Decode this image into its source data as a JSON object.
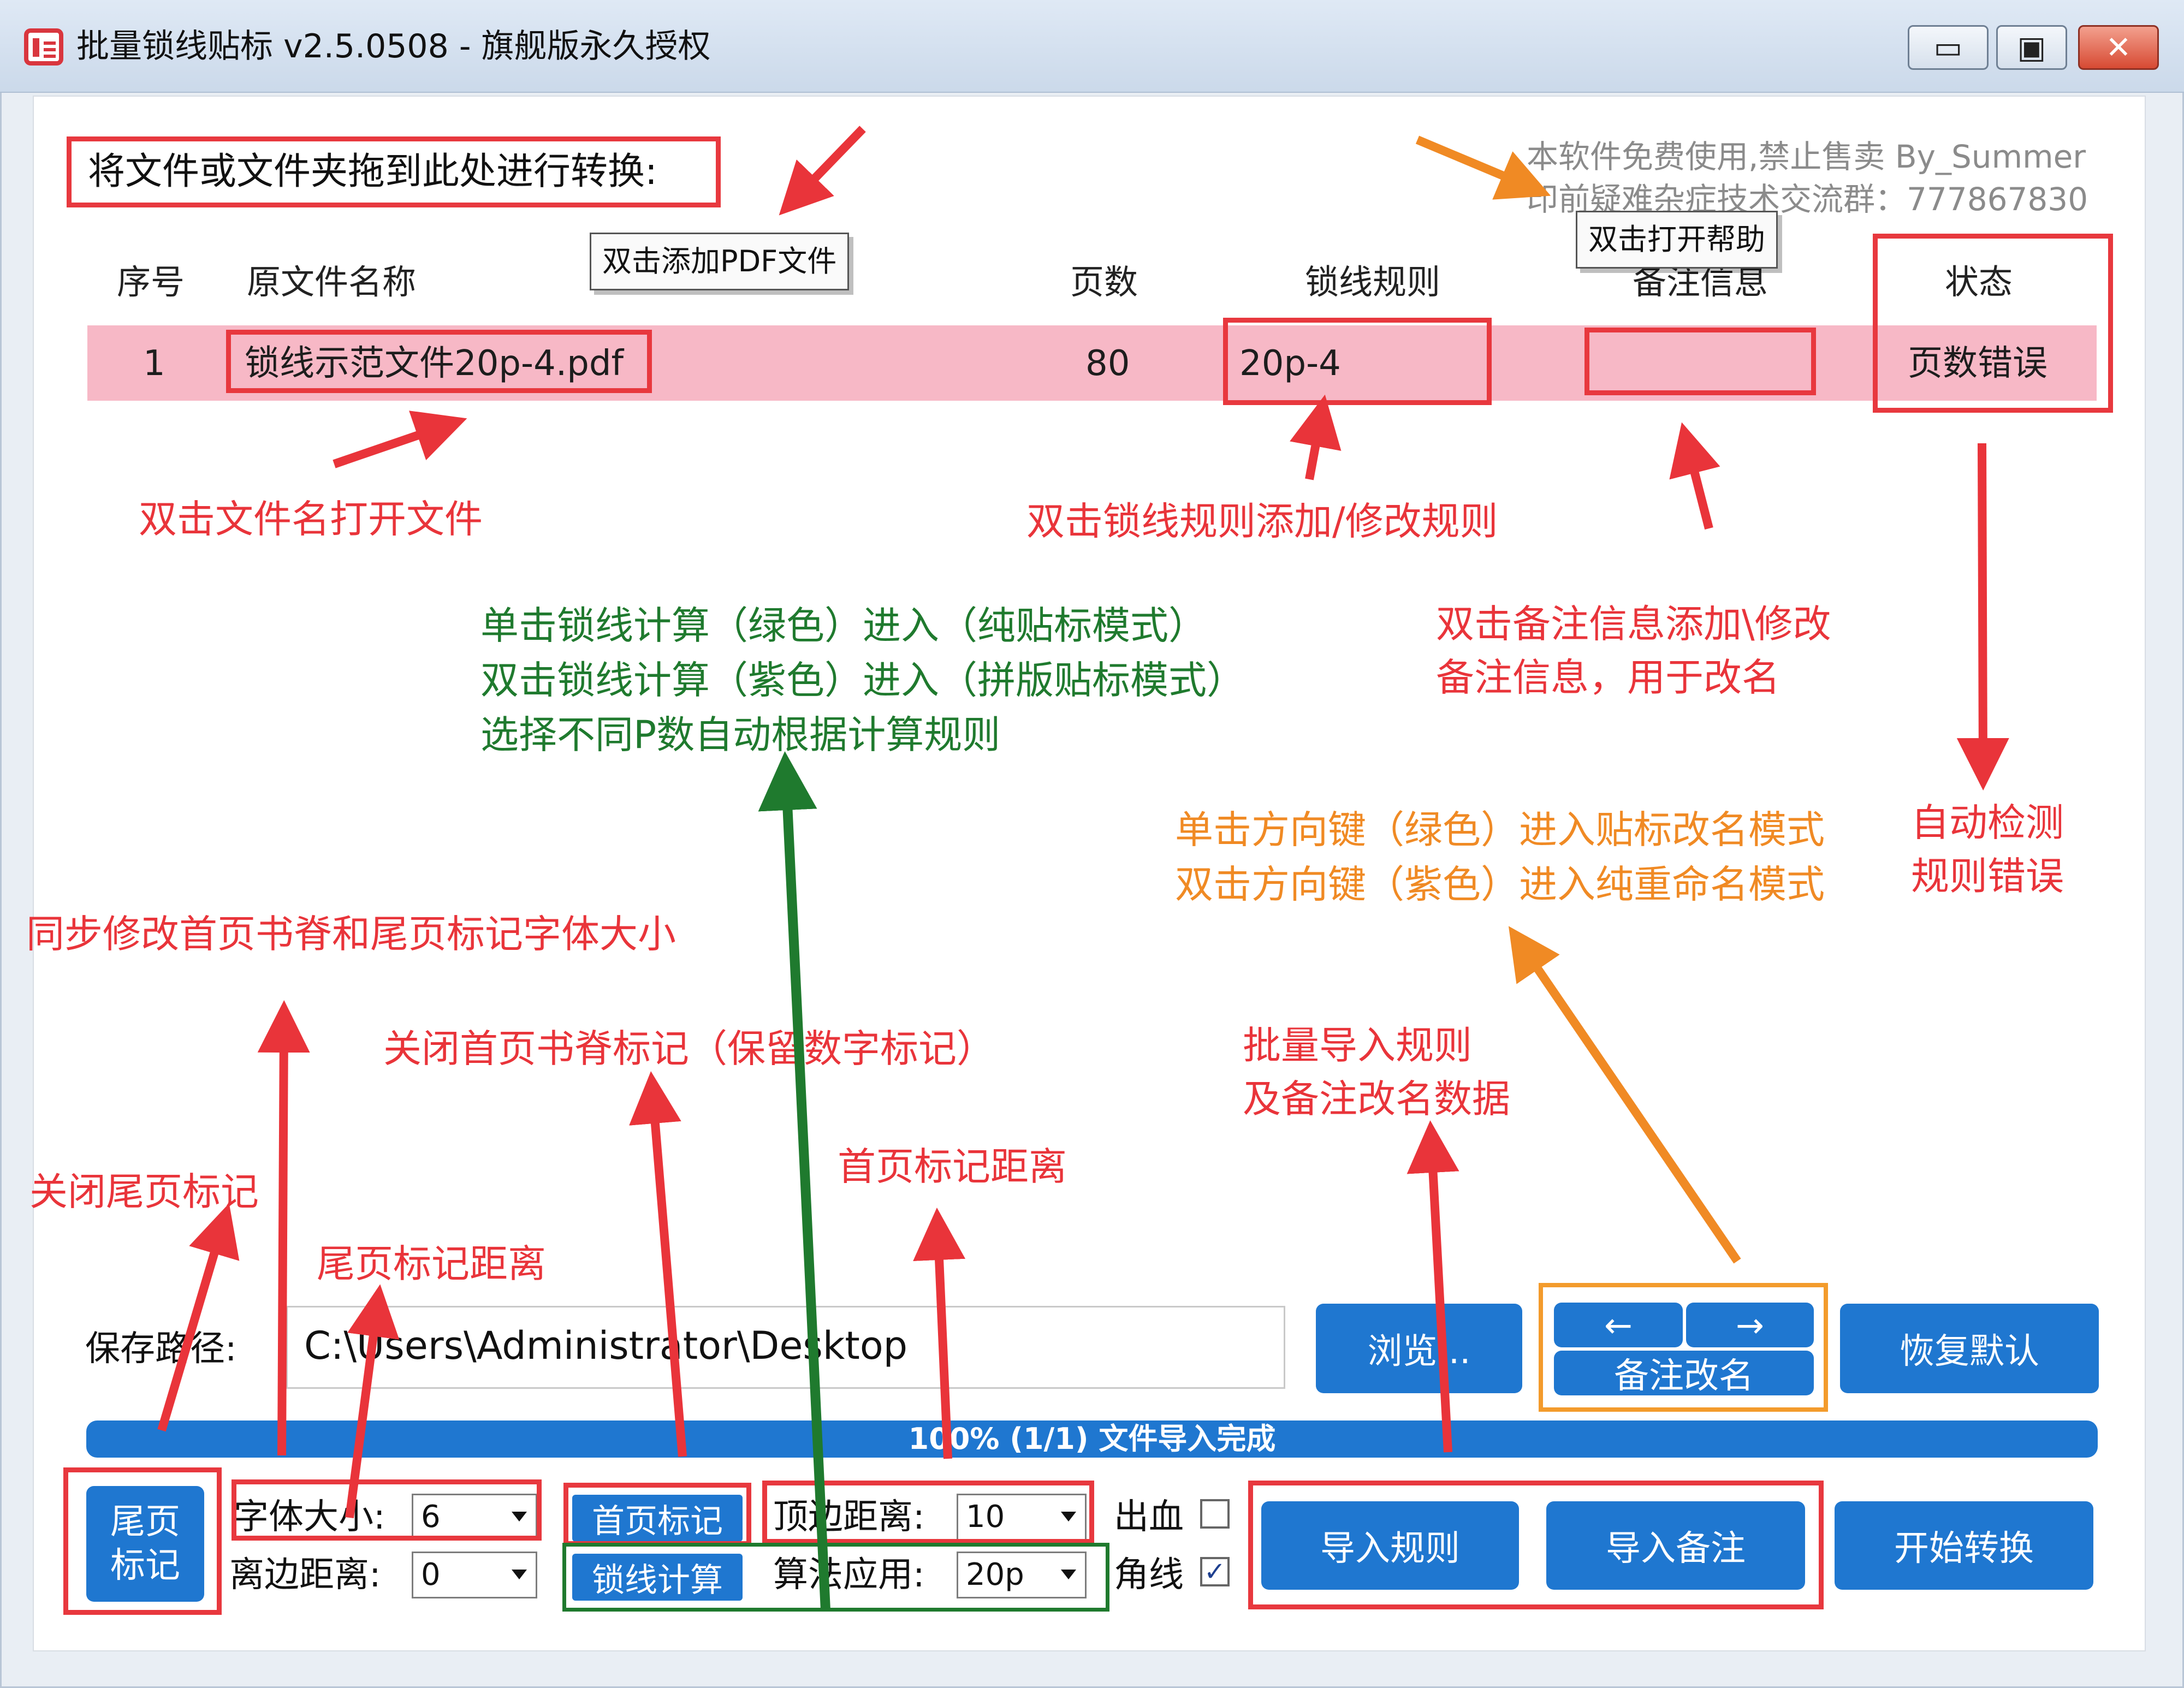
{
  "window": {
    "title": "批量锁线贴标 v2.5.0508 - 旗舰版永久授权",
    "minimize_icon": "minimize-icon",
    "maximize_icon": "maximize-icon",
    "close_icon": "close-icon",
    "minimize_glyph": "▭",
    "maximize_glyph": "▣",
    "close_glyph": "✕"
  },
  "drop_label": "将文件或文件夹拖到此处进行转换:",
  "info": {
    "line1": "本软件免费使用,禁止售卖  By_Summer",
    "line2": "印前疑难杂症技术交流群：777867830"
  },
  "tooltips": {
    "add_pdf": "双击添加PDF文件",
    "open_help": "双击打开帮助"
  },
  "table": {
    "headers": [
      "序号",
      "原文件名称",
      "页数",
      "锁线规则",
      "备注信息",
      "状态"
    ],
    "rows": [
      {
        "index": "1",
        "filename": "锁线示范文件20p-4.pdf",
        "pages": "80",
        "rule": "20p-4",
        "note": "",
        "status": "页数错误"
      }
    ]
  },
  "annotations": {
    "open_file": "双击文件名打开文件",
    "edit_rule": "双击锁线规则添加/修改规则",
    "green_1": "单击锁线计算（绿色）进入（纯贴标模式）",
    "green_2": "双击锁线计算（紫色）进入（拼版贴标模式）",
    "green_3": "选择不同P数自动根据计算规则",
    "note_1": "双击备注信息添加\\修改",
    "note_2": "备注信息，用于改名",
    "orange_1": "单击方向键（绿色）进入贴标改名模式",
    "orange_2": "双击方向键（紫色）进入纯重命名模式",
    "auto_check_1": "自动检测",
    "auto_check_2": "规则错误",
    "font_size_sync": "同步修改首页书脊和尾页标记字体大小",
    "close_first_spine": "关闭首页书脊标记（保留数字标记）",
    "batch_import_1": "批量导入规则",
    "batch_import_2": "及备注改名数据",
    "first_page_distance": "首页标记距离",
    "close_last_mark": "关闭尾页标记",
    "last_page_distance": "尾页标记距离"
  },
  "bottom": {
    "save_path_label": "保存路径:",
    "save_path_value": "C:\\Users\\Administrator\\Desktop",
    "browse": "浏览...",
    "left_arrow": "←",
    "right_arrow": "→",
    "note_rename": "备注改名",
    "restore_default": "恢复默认",
    "progress_text": "100% (1/1) 文件导入完成",
    "progress_value": 1.0,
    "last_page_mark_line1": "尾页",
    "last_page_mark_line2": "标记",
    "font_size_label": "字体大小:",
    "font_size_value": "6",
    "edge_distance_label": "离边距离:",
    "edge_distance_value": "0",
    "first_page_mark": "首页标记",
    "lock_calc": "锁线计算",
    "top_distance_label": "顶边距离:",
    "top_distance_value": "10",
    "algorithm_label": "算法应用:",
    "algorithm_value": "20p",
    "bleed_label": "出血",
    "bleed_checked": false,
    "corner_label": "角线",
    "corner_checked": true,
    "check_glyph": "✓",
    "import_rules": "导入规则",
    "import_notes": "导入备注",
    "start_convert": "开始转换"
  },
  "colors": {
    "accent_blue": "#1f77d0",
    "annotation_red": "#e9343a",
    "annotation_green": "#1f7a2e",
    "annotation_orange": "#f08a24",
    "row_highlight": "#f7b8c6"
  }
}
